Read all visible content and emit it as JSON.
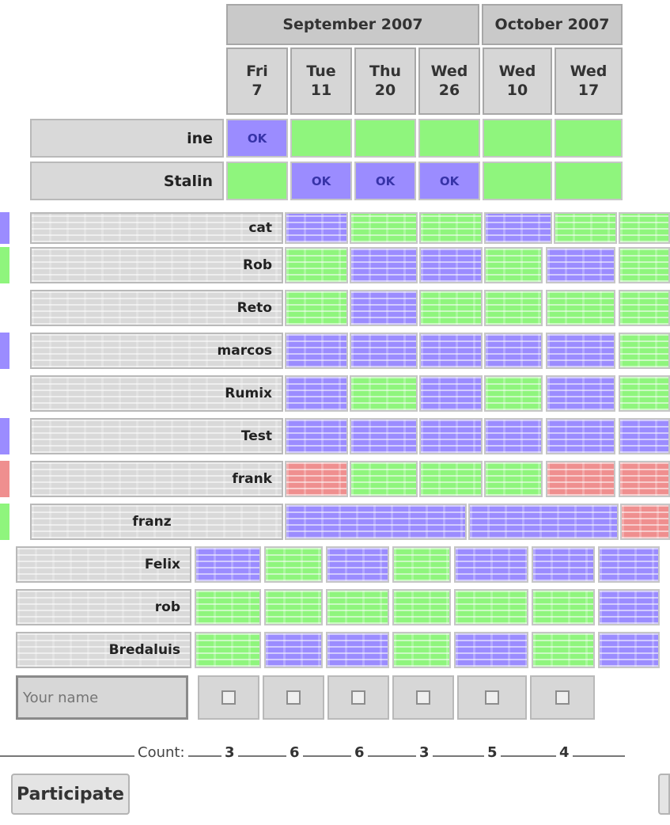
{
  "poll": {
    "months": [
      {
        "label": "September 2007"
      },
      {
        "label": "October 2007"
      }
    ],
    "dates": [
      {
        "day": "Fri",
        "num": "7"
      },
      {
        "day": "Tue",
        "num": "11"
      },
      {
        "day": "Thu",
        "num": "20"
      },
      {
        "day": "Wed",
        "num": "26"
      },
      {
        "day": "Wed",
        "num": "10"
      },
      {
        "day": "Wed",
        "num": "17"
      }
    ],
    "ok_label": "OK",
    "participants": [
      {
        "name": "ine"
      },
      {
        "name": "Stalin"
      },
      {
        "name": "cat"
      },
      {
        "name": "Rob"
      },
      {
        "name": "Reto"
      },
      {
        "name": "marcos"
      },
      {
        "name": "Rumix"
      },
      {
        "name": "Test"
      },
      {
        "name": "frank"
      },
      {
        "name": "franz"
      },
      {
        "name": "Felix"
      },
      {
        "name": "rob"
      },
      {
        "name": "Bredaluis"
      }
    ]
  },
  "form": {
    "your_name_placeholder": "Your name"
  },
  "footer": {
    "count_label": "Count:",
    "counts": [
      "3",
      "6",
      "6",
      "3",
      "5",
      "4"
    ],
    "participate_button": "Participate"
  },
  "colors": {
    "yes": "#8ff57d",
    "ok": "#9b8cff",
    "no": "#ef8f8f",
    "header": "#c9c9c9"
  }
}
